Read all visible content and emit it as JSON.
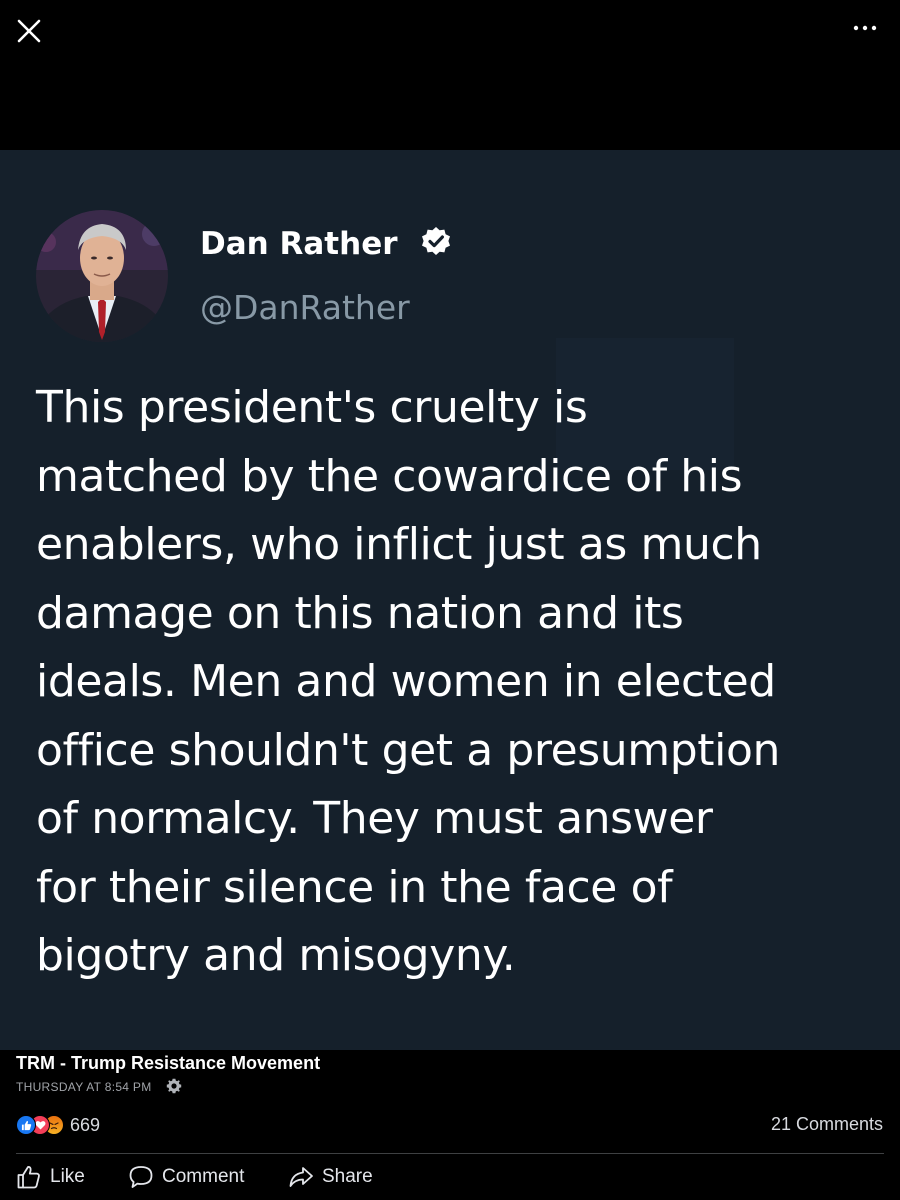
{
  "top_bar": {
    "close_icon": "close-icon",
    "more_icon": "more-options-icon"
  },
  "tweet": {
    "author_name": "Dan Rather",
    "author_handle": "@DanRather",
    "verified_icon": "verified-badge-icon",
    "text_lines": [
      "This president's cruelty is",
      "matched by the cowardice of his",
      "enablers, who inflict just as much",
      "damage on this nation and its",
      "ideals. Men and women in elected",
      "office shouldn't get a presumption",
      "of normalcy. They must answer",
      "for their silence in the face of",
      "bigotry and misogyny."
    ],
    "background_color": "#15202b",
    "handle_color": "#8899a6"
  },
  "post": {
    "page_name": "TRM - Trump Resistance Movement",
    "timestamp": "THURSDAY AT 8:54 PM",
    "audience_icon": "gear-icon",
    "reactions": [
      "like",
      "love",
      "angry"
    ],
    "reaction_count": "669",
    "comments": "21 Comments"
  },
  "actions": {
    "like_label": "Like",
    "comment_label": "Comment",
    "share_label": "Share"
  },
  "colors": {
    "like_blue": "#1877f2",
    "love_red": "#f33e58",
    "angry_orange": "#e9710f"
  }
}
